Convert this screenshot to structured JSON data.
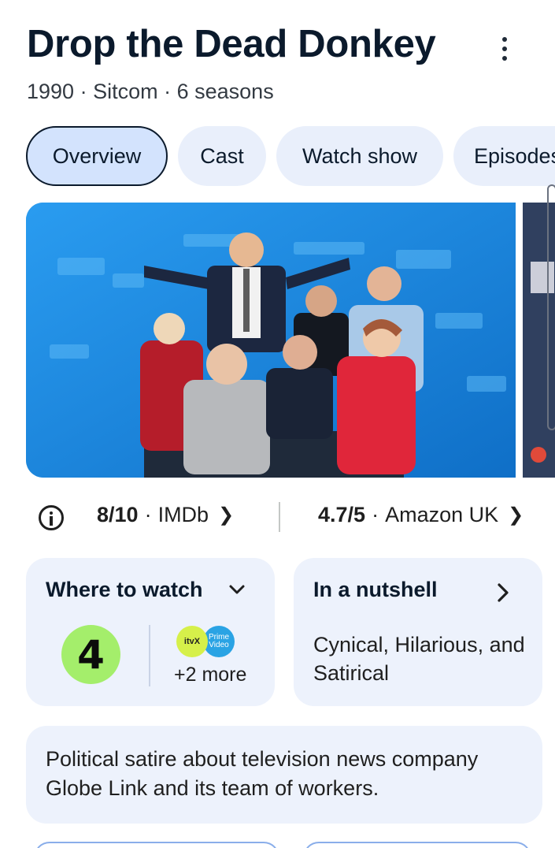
{
  "header": {
    "title": "Drop the Dead Donkey",
    "year": "1990",
    "genre": "Sitcom",
    "seasons": "6 seasons",
    "separator": " · "
  },
  "tabs": [
    {
      "label": "Overview",
      "active": true
    },
    {
      "label": "Cast",
      "active": false
    },
    {
      "label": "Watch show",
      "active": false
    },
    {
      "label": "Episodes",
      "active": false
    }
  ],
  "ratings": [
    {
      "score": "8/10",
      "source": "IMDb"
    },
    {
      "score": "4.7/5",
      "source": "Amazon UK"
    }
  ],
  "where_to_watch": {
    "title": "Where to watch",
    "provider_primary": "4",
    "provider_logos": [
      "itvX",
      "Prime Video"
    ],
    "more": "+2 more"
  },
  "nutshell": {
    "title": "In a nutshell",
    "text": "Cynical, Hilarious, and Satirical"
  },
  "description": "Political satire about television news company Globe Link and its team of workers.",
  "colors": {
    "accent_tab_bg": "#d3e3fd",
    "chip_bg": "#e9effb",
    "card_bg": "#edf2fc",
    "channel4_green": "#a4ee6b",
    "title_color": "#0b1a2c"
  }
}
